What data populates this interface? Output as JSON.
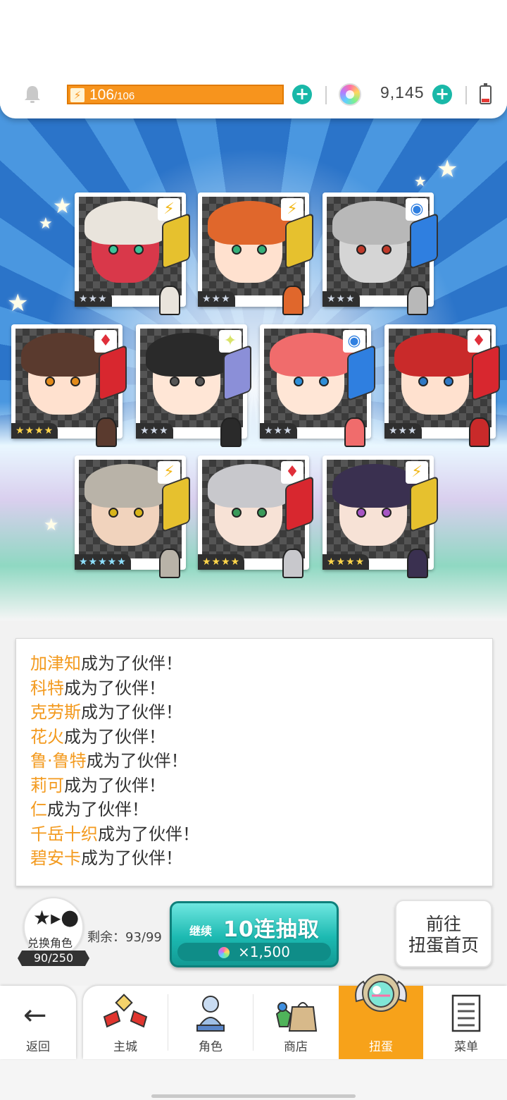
{
  "header": {
    "energy_current": "106",
    "energy_max": "/106",
    "gem_count": "9,145"
  },
  "cards": [
    {
      "element": "⚡",
      "element_color": "#f2b81b",
      "stars": "★★★",
      "rarity": 3,
      "hair": "#e9e4dc",
      "face": "#d9384a",
      "eye": "#3cc49a",
      "weapon": "#e6c12e"
    },
    {
      "element": "⚡",
      "element_color": "#f2b81b",
      "stars": "★★★",
      "rarity": 3,
      "hair": "#e0672c",
      "face": "#ffe1cf",
      "eye": "#35b07a",
      "weapon": "#e6c12e"
    },
    {
      "element": "◉",
      "element_color": "#2f7fe0",
      "stars": "★★★",
      "rarity": 3,
      "hair": "#b8b8b8",
      "face": "#d5d5d5",
      "eye": "#c03a2a",
      "weapon": "#2f7fe0"
    },
    {
      "element": "♦",
      "element_color": "#e02f3a",
      "stars": "★★★★",
      "rarity": 4,
      "hair": "#5a3a2e",
      "face": "#ffe1cf",
      "eye": "#e28a1a",
      "weapon": "#d8272f"
    },
    {
      "element": "✦",
      "element_color": "#d9e36a",
      "stars": "★★★",
      "rarity": 3,
      "hair": "#2a2a2a",
      "face": "#ffe6d6",
      "eye": "#555555",
      "weapon": "#8b8fd8"
    },
    {
      "element": "◉",
      "element_color": "#2f7fe0",
      "stars": "★★★",
      "rarity": 3,
      "hair": "#f06c6c",
      "face": "#ffe6d6",
      "eye": "#2f8fd8",
      "weapon": "#2f7fe0"
    },
    {
      "element": "♦",
      "element_color": "#e02f3a",
      "stars": "★★★",
      "rarity": 3,
      "hair": "#c92a2a",
      "face": "#ffe1cf",
      "eye": "#2f78c4",
      "weapon": "#d8272f"
    },
    {
      "element": "⚡",
      "element_color": "#f2b81b",
      "stars": "★★★★★",
      "rarity": 5,
      "hair": "#b9b3a8",
      "face": "#f1d3bd",
      "eye": "#d8b41a",
      "weapon": "#e6c12e"
    },
    {
      "element": "♦",
      "element_color": "#e02f3a",
      "stars": "★★★★",
      "rarity": 4,
      "hair": "#c8c8cc",
      "face": "#f7e2d6",
      "eye": "#3a9a5a",
      "weapon": "#d8272f"
    },
    {
      "element": "⚡",
      "element_color": "#f2b81b",
      "stars": "★★★★",
      "rarity": 4,
      "hair": "#3a3050",
      "face": "#f7e2d6",
      "eye": "#a655c4",
      "weapon": "#e6c12e"
    }
  ],
  "log": {
    "suffix": "成为了伙伴！",
    "names": [
      "加津知",
      "科特",
      "克劳斯",
      "花火",
      "鲁·鲁特",
      "莉可",
      "仁",
      "千岳十织",
      "碧安卡"
    ]
  },
  "exchange": {
    "label": "兑换角色",
    "count": "90/250"
  },
  "remaining": "剩余：93/99",
  "draw": {
    "continue_label": "继续",
    "main_label": "10连抽取",
    "cost": "×1,500"
  },
  "gacha_home": {
    "line1": "前往",
    "line2": "扭蛋首页"
  },
  "nav": {
    "back": "返回",
    "tabs": [
      "主城",
      "角色",
      "商店",
      "扭蛋",
      "菜单"
    ],
    "active_index": 3
  },
  "colors": {
    "accent_teal": "#1cb9b1",
    "accent_orange": "#f7a21a",
    "name_orange": "#f39a1e"
  }
}
